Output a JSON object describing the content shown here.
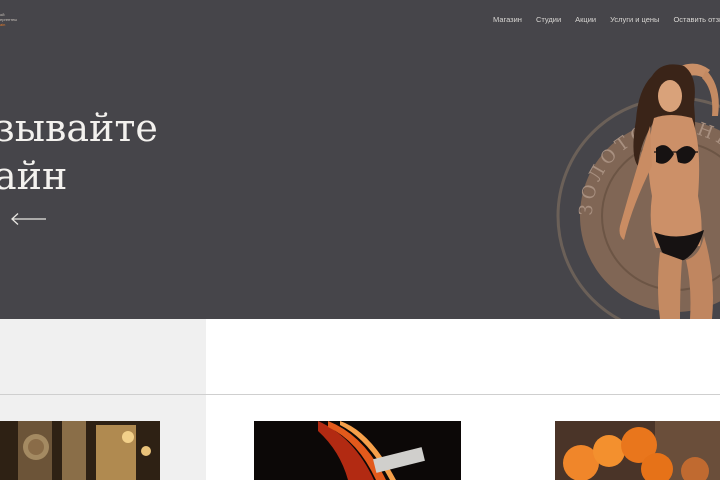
{
  "header": {
    "logo_lines": [
      "ой",
      "ергентеы",
      "ain"
    ]
  },
  "nav": {
    "items": [
      "Магазин",
      "Студии",
      "Акции",
      "Услуги и цены",
      "Оставить отзыв"
    ]
  },
  "hero": {
    "headline_line1": "зывайте",
    "headline_line2": "айн",
    "badge_text": "ЗОЛОТО САНЫ"
  },
  "colors": {
    "hero_bg": "#46454a",
    "accent": "#e07a2c",
    "panel_bg": "#f0f0f0"
  },
  "icons": {
    "back_arrow": "arrow-left-icon"
  }
}
